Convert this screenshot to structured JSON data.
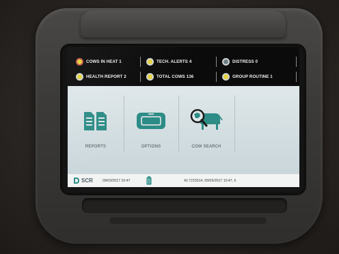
{
  "status_bar": {
    "items": [
      {
        "label": "COWS IN HEAT 1",
        "dot": "yellow-red"
      },
      {
        "label": "TECH. ALERTS 4",
        "dot": "yellow"
      },
      {
        "label": "DISTRESS 0",
        "dot": "gray"
      },
      {
        "label": "HEALTH REPORT 2",
        "dot": "yellow"
      },
      {
        "label": "TOTAL COWS 136",
        "dot": "yellow"
      },
      {
        "label": "GROUP ROUTINE 1",
        "dot": "yellow"
      }
    ]
  },
  "main_menu": {
    "tiles": [
      {
        "label": "REPORTS",
        "icon": "reports-icon"
      },
      {
        "label": "OPTIONS",
        "icon": "options-icon"
      },
      {
        "label": "COW SEARCH",
        "icon": "cow-search-icon"
      }
    ]
  },
  "bottom_bar": {
    "brand": "SCR",
    "date": "09/03/2017 10:47",
    "battery_icon": "battery-icon",
    "coordinates": "42.7215514, 09/03/2017 10:47, 6"
  },
  "colors": {
    "teal": "#2d8c86",
    "alert_yellow": "#e4d23a",
    "panel_bg": "#d6e0e3",
    "status_bg": "#0b0b0b"
  }
}
